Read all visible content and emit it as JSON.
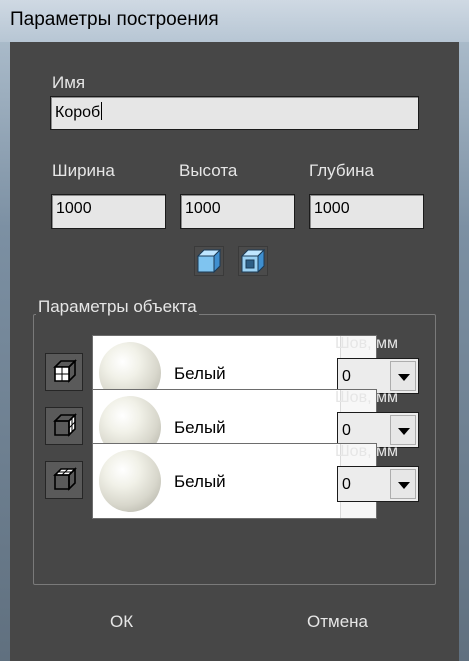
{
  "window": {
    "title": "Параметры построения"
  },
  "name": {
    "label": "Имя",
    "value": "Короб"
  },
  "size": {
    "width": {
      "label": "Ширина",
      "value": "1000"
    },
    "height": {
      "label": "Высота",
      "value": "1000"
    },
    "depth": {
      "label": "Глубина",
      "value": "1000"
    }
  },
  "view_buttons": [
    {
      "icon": "solid-box-icon"
    },
    {
      "icon": "inner-box-icon"
    }
  ],
  "object_params": {
    "title": "Параметры объекта",
    "rows": [
      {
        "face_icon": "box-face-icon",
        "material": "Белый",
        "plus": "+",
        "seam_label": "Шов, мм",
        "seam_value": "0"
      },
      {
        "face_icon": "box-face-icon",
        "material": "Белый",
        "plus": "+",
        "seam_label": "Шов, мм",
        "seam_value": "0"
      },
      {
        "face_icon": "box-face-icon",
        "material": "Белый",
        "plus": "+",
        "seam_label": "Шов, мм",
        "seam_value": "0"
      }
    ]
  },
  "footer": {
    "ok": "ОК",
    "cancel": "Отмена"
  },
  "colors": {
    "background": "#474747",
    "titlebar": "#c1ceda",
    "field": "#e6e6e6",
    "text": "#e6e6e6"
  }
}
